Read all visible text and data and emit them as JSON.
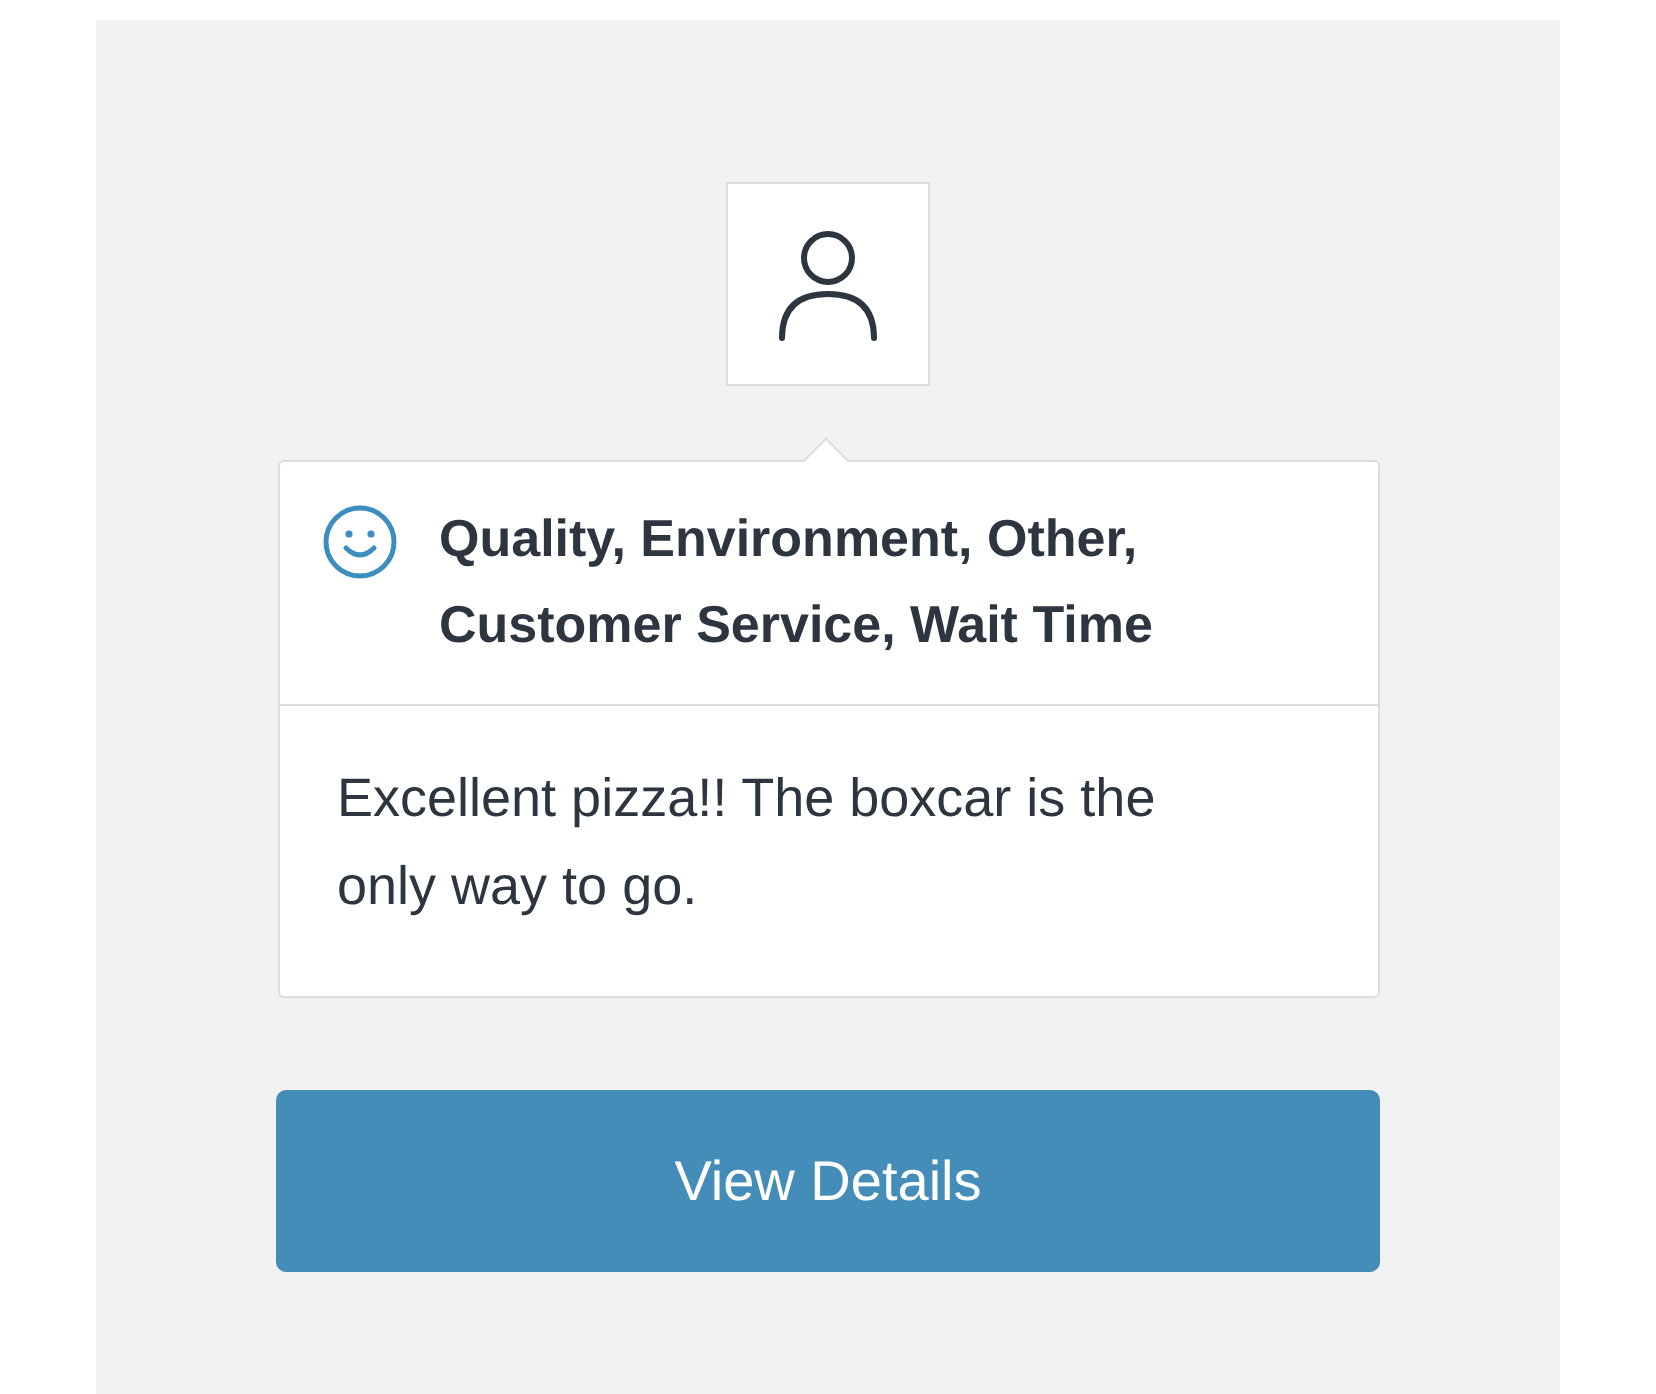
{
  "feedback": {
    "kind": "positive",
    "categories": "Quality, Environment, Other, Customer Service, Wait Time",
    "comment": "Excellent pizza!! The boxcar is the only way to go."
  },
  "button": "View Details"
}
